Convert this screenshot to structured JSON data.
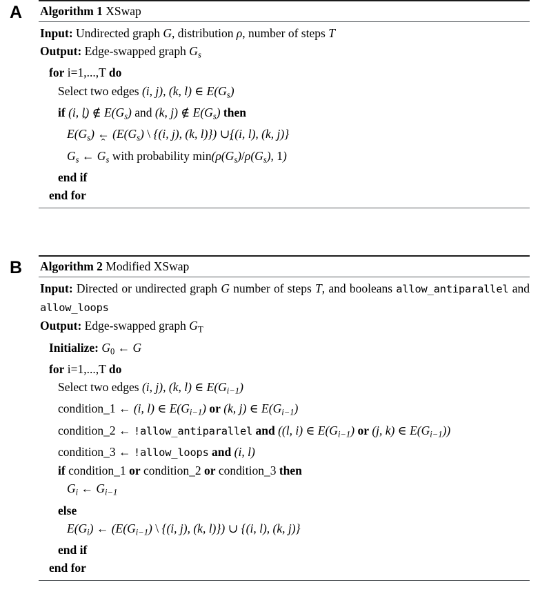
{
  "figure": {
    "panels": [
      {
        "letter": "A",
        "title_bold": "Algorithm 1",
        "title_rest": "XSwap",
        "lines": [
          {
            "id": "a-input",
            "level": 0,
            "keyword": "Input:",
            "text": "Undirected graph G, distribution ρ, number of steps T"
          },
          {
            "id": "a-output",
            "level": 0,
            "keyword": "Output:",
            "text": "Edge-swapped graph Gₛ"
          },
          {
            "id": "a-for",
            "level": 1,
            "keyword": "for",
            "text": "i=1,...,T do"
          },
          {
            "id": "a-select",
            "level": 2,
            "keyword": "",
            "text": "Select two edges (i, j), (k, l) ∈ E(Gₛ)"
          },
          {
            "id": "a-if",
            "level": 2,
            "keyword": "if",
            "text": "(i, l) ∉ E(Gₛ) and (k, j) ∉ E(Gₛ) then"
          },
          {
            "id": "a-assign-e",
            "level": 3,
            "keyword": "",
            "text": "E(Ĝₛ) ← (E(Gₛ) \\ {(i, j), (k, l)}) ∪{(i, l), (k, j)}"
          },
          {
            "id": "a-assign-g",
            "level": 3,
            "keyword": "",
            "text": "Gₛ ← Ĝₛ with probability min(ρ(Ĝₛ)/ρ(Gₛ), 1)"
          },
          {
            "id": "a-endif",
            "level": 2,
            "keyword": "end if",
            "text": ""
          },
          {
            "id": "a-endfor",
            "level": 1,
            "keyword": "end for",
            "text": ""
          }
        ]
      },
      {
        "letter": "B",
        "title_bold": "Algorithm 2",
        "title_rest": "Modified XSwap",
        "lines": [
          {
            "id": "b-input",
            "level": 0,
            "keyword": "Input:",
            "text": "Directed or undirected graph G number of steps T, and booleans allow_antiparallel and allow_loops"
          },
          {
            "id": "b-output",
            "level": 0,
            "keyword": "Output:",
            "text": "Edge-swapped graph G_T"
          },
          {
            "id": "b-init",
            "level": 1,
            "keyword": "Initialize:",
            "text": "G₀ ← G"
          },
          {
            "id": "b-for",
            "level": 1,
            "keyword": "for",
            "text": "i=1,...,T do"
          },
          {
            "id": "b-select",
            "level": 2,
            "keyword": "",
            "text": "Select two edges (i, j), (k, l) ∈ E(Gᵢ₋₁)"
          },
          {
            "id": "b-cond1",
            "level": 2,
            "keyword": "",
            "text": "condition_1 ← (i, l) ∈ E(Gᵢ₋₁) or (k, j) ∈ E(Gᵢ₋₁)"
          },
          {
            "id": "b-cond2",
            "level": 2,
            "keyword": "",
            "text": "condition_2 ← !allow_antiparallel and ((l, i) ∈ E(Gᵢ₋₁) or (j, k) ∈ E(Gᵢ₋₁))"
          },
          {
            "id": "b-cond3",
            "level": 2,
            "keyword": "",
            "text": "condition_3 ← !allow_loops and (i, l)"
          },
          {
            "id": "b-if",
            "level": 2,
            "keyword": "if",
            "text": "condition_1 or condition_2 or condition_3 then"
          },
          {
            "id": "b-gi",
            "level": 3,
            "keyword": "",
            "text": "Gᵢ ← Gᵢ₋₁"
          },
          {
            "id": "b-else",
            "level": 2,
            "keyword": "else",
            "text": ""
          },
          {
            "id": "b-assign-e",
            "level": 3,
            "keyword": "",
            "text": "E(Gᵢ) ← (E(Gᵢ₋₁) \\ {(i, j), (k, l)}) ∪ {(i, l), (k, j)}"
          },
          {
            "id": "b-endif",
            "level": 2,
            "keyword": "end if",
            "text": ""
          },
          {
            "id": "b-endfor",
            "level": 1,
            "keyword": "end for",
            "text": ""
          }
        ]
      }
    ],
    "tokens": {
      "kw_input": "Input:",
      "kw_output": "Output:",
      "kw_for": "for",
      "kw_do": "do",
      "kw_if": "if",
      "kw_then": "then",
      "kw_else": "else",
      "kw_endif": "end if",
      "kw_endfor": "end for",
      "kw_and": "and",
      "kw_or": "or",
      "kw_initialize": "Initialize:",
      "kw_select": "Select two edges",
      "kw_with_prob": "with probability",
      "kw_min": "min",
      "loop_range": "i=1,...,T",
      "mono_antiparallel": "allow_antiparallel",
      "mono_loops": "allow_loops",
      "cond1": "condition_1",
      "cond2": "condition_2",
      "cond3": "condition_3",
      "a_input_text": "Undirected graph",
      "a_input_text2": ", distribution",
      "a_input_text3": ", number of steps",
      "a_output_text": "Edge-swapped graph",
      "b_input_text": "Directed or undirected graph",
      "b_input_text2": "number of steps",
      "b_input_text3": ", and booleans",
      "b_output_text": "Edge-swapped graph"
    },
    "colors": {
      "text": "#000000",
      "rule_thick": "#1a1a1a",
      "rule_thin": "#555a5e",
      "background": "#ffffff"
    }
  }
}
